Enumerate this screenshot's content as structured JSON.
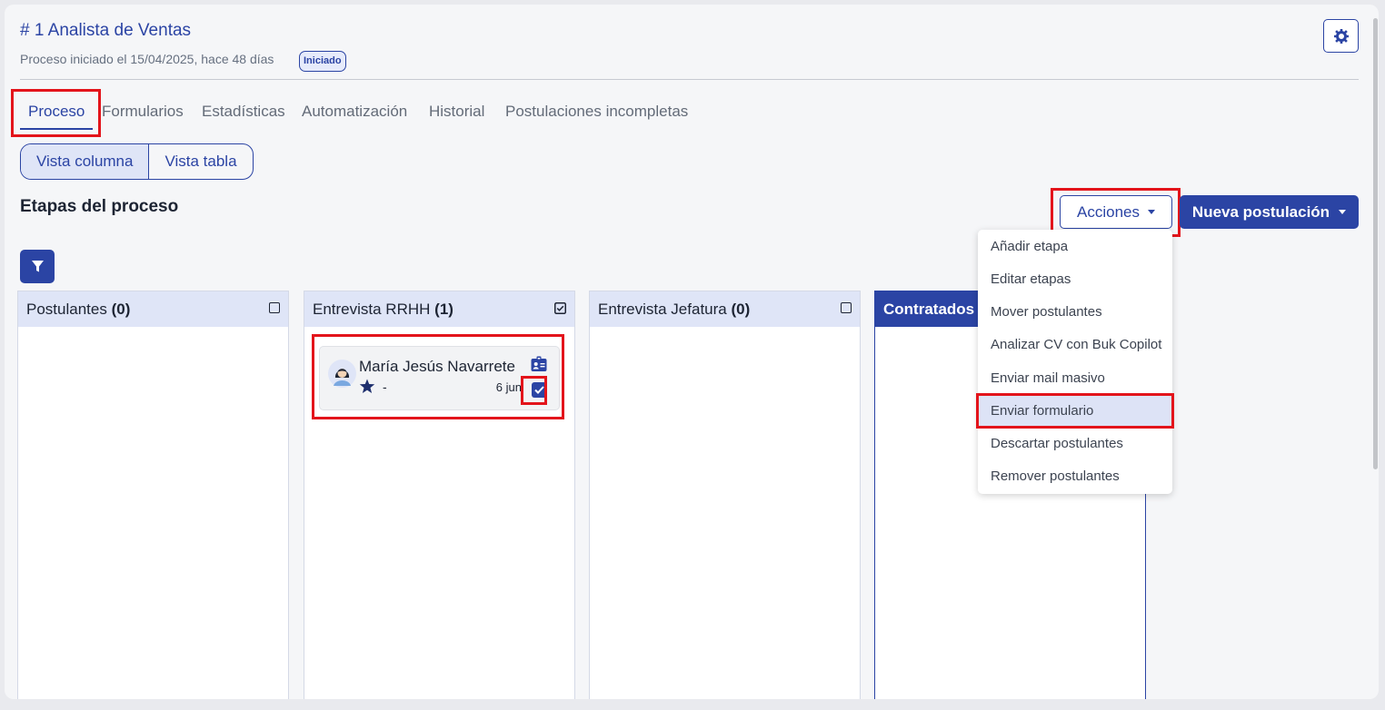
{
  "header": {
    "title": "# 1 Analista de Ventas",
    "subtitle": "Proceso iniciado el 15/04/2025, hace 48 días",
    "status_badge": "Iniciado"
  },
  "tabs": [
    {
      "label": "Proceso",
      "active": true
    },
    {
      "label": "Formularios"
    },
    {
      "label": "Estadísticas"
    },
    {
      "label": "Automatización"
    },
    {
      "label": "Historial"
    },
    {
      "label": "Postulaciones incompletas"
    }
  ],
  "view_toggle": {
    "column": "Vista columna",
    "table": "Vista tabla",
    "selected": "Vista columna"
  },
  "section_title": "Etapas del proceso",
  "actions": {
    "label": "Acciones"
  },
  "new_application": {
    "label": "Nueva postulación"
  },
  "menu_items": [
    "Añadir etapa",
    "Editar etapas",
    "Mover postulantes",
    "Analizar CV con Buk Copilot",
    "Enviar mail masivo",
    "Enviar formulario",
    "Descartar postulantes",
    "Remover postulantes"
  ],
  "menu_highlighted": "Enviar formulario",
  "columns": [
    {
      "name": "Postulantes",
      "count": "(0)",
      "checked": false
    },
    {
      "name": "Entrevista RRHH",
      "count": "(1)",
      "checked": true
    },
    {
      "name": "Entrevista Jefatura",
      "count": "(0)",
      "checked": false
    },
    {
      "name": "Contratados (",
      "count": ""
    }
  ],
  "candidate": {
    "name": "María Jesús Navarrete",
    "rating": "-",
    "date": "6 jun",
    "selected": true
  },
  "colors": {
    "primary": "#2b44a4",
    "highlight_box": "#e3141b"
  },
  "icons": [
    "gear-icon",
    "filter-icon",
    "caret-down-icon",
    "avatar-icon",
    "star-icon",
    "id-card-icon",
    "checkbox-icon"
  ]
}
